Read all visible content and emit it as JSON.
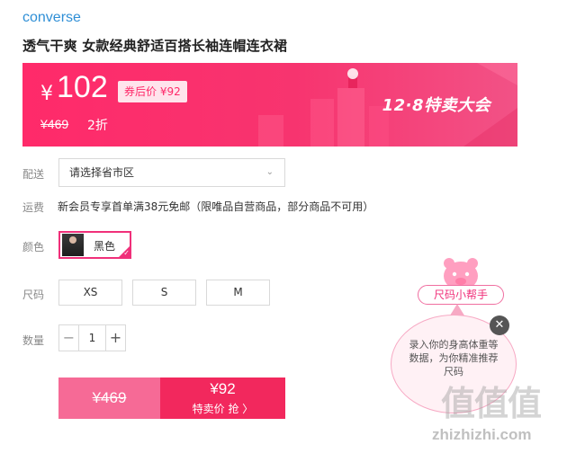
{
  "brand": "converse",
  "product_title": "透气干爽 女款经典舒适百搭长袖连帽连衣裙",
  "price_banner": {
    "currency": "¥",
    "price": "102",
    "coupon_label": "券后价 ¥92",
    "original_price": "¥469",
    "discount": "2折",
    "event_name": "12·8特卖大会",
    "colors": {
      "start": "#ff2a6a",
      "end": "#f25286"
    }
  },
  "delivery": {
    "label": "配送",
    "placeholder": "请选择省市区"
  },
  "shipping": {
    "label": "运费",
    "text": "新会员专享首单满38元免邮（限唯品自营商品，部分商品不可用）"
  },
  "color": {
    "label": "颜色",
    "selected": "黑色"
  },
  "size": {
    "label": "尺码",
    "options": [
      "XS",
      "S",
      "M"
    ]
  },
  "quantity": {
    "label": "数量",
    "value": "1",
    "minus": "−",
    "plus": "+"
  },
  "buy": {
    "original_price": "¥469",
    "sale_price": "¥92",
    "cta": "特卖价 抢 〉"
  },
  "size_helper": {
    "pill_label": "尺码小帮手",
    "bubble_text": "录入你的身高体重等数据，为你精准推荐尺码",
    "close": "✕"
  },
  "watermark": {
    "chars": "值值值",
    "url": "zhizhizhi.com"
  },
  "icons": [
    "chevron-down-icon",
    "check-icon",
    "close-icon",
    "mascot-icon"
  ]
}
